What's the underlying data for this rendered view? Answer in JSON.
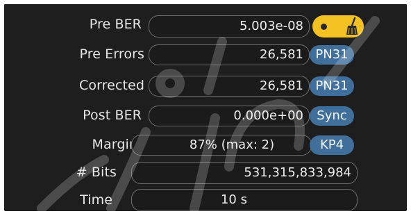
{
  "rows": [
    {
      "label": "Pre BER",
      "value": "5.003e-08",
      "action": {
        "type": "toggle",
        "icon": "broom-icon",
        "state": "on",
        "color": "#f3c222"
      }
    },
    {
      "label": "Pre Errors",
      "value": "26,581",
      "action": {
        "type": "button",
        "text": "PN31"
      }
    },
    {
      "label": "Corrected",
      "value": "26,581",
      "action": {
        "type": "button",
        "text": "PN31"
      }
    },
    {
      "label": "Post BER",
      "value": "0.000e+00",
      "action": {
        "type": "button",
        "text": "Sync"
      }
    },
    {
      "label": "Margin",
      "value": "87% (max: 2)",
      "action": {
        "type": "button",
        "text": "KP4"
      }
    },
    {
      "label": "# Bits",
      "value": "531,315,833,984"
    },
    {
      "label": "Time",
      "value": "10 s"
    }
  ],
  "colors": {
    "background": "#1e1e1f",
    "field_border": "#6f6f70",
    "button": "#3f6f9a",
    "toggle": "#f3c222",
    "text": "#e6e6e6"
  }
}
